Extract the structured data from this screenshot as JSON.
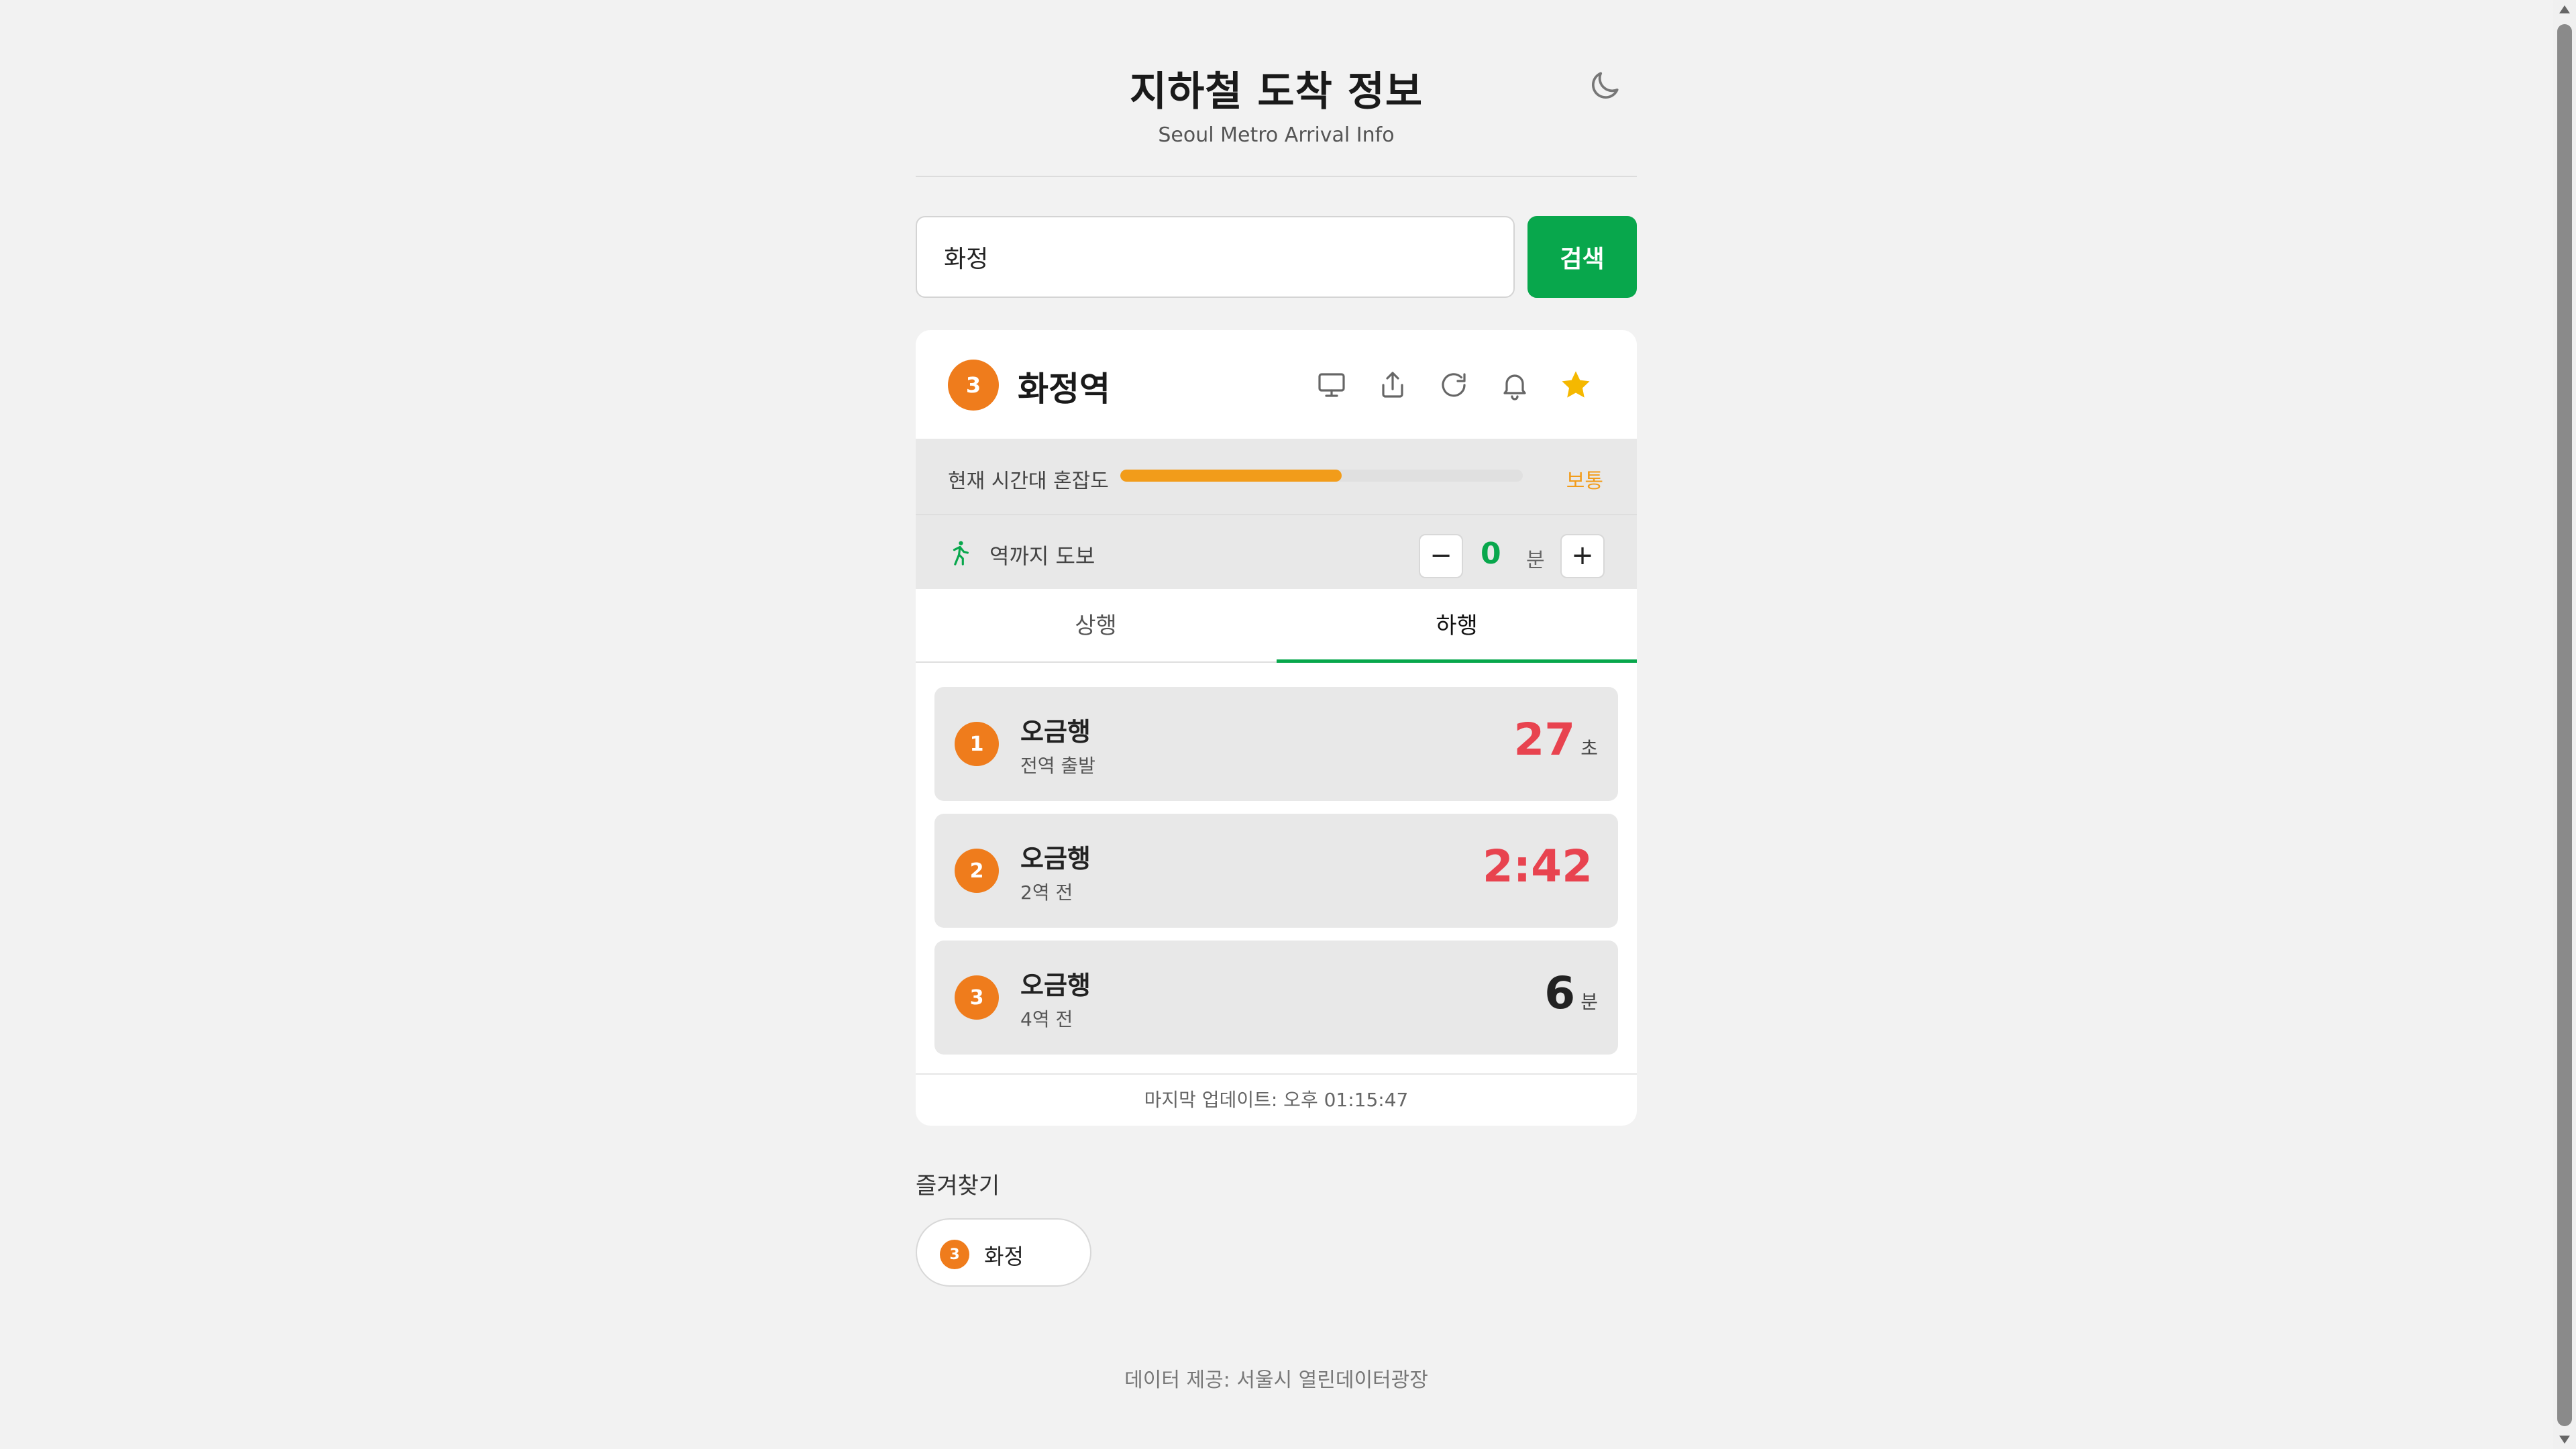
{
  "header": {
    "title": "지하철 도착 정보",
    "subtitle": "Seoul Metro Arrival Info",
    "theme_icon": "moon-icon"
  },
  "search": {
    "value": "화정",
    "button_label": "검색"
  },
  "station": {
    "line": "3",
    "line_color": "#ef7c1c",
    "name": "화정역",
    "icons": [
      "monitor-icon",
      "share-icon",
      "refresh-icon",
      "bell-icon",
      "star-icon"
    ],
    "favorite_color": "#f5b800"
  },
  "congestion": {
    "label": "현재 시간대 혼잡도",
    "level_percent": 55,
    "status": "보통",
    "color": "#f29c1a"
  },
  "walk": {
    "label": "역까지 도보",
    "minutes": "0",
    "unit": "분",
    "minus": "−",
    "plus": "+"
  },
  "tabs": [
    {
      "label": "상행",
      "active": false
    },
    {
      "label": "하행",
      "active": true
    }
  ],
  "arrivals": [
    {
      "order": "1",
      "destination": "오금행",
      "status": "전역 출발",
      "time": "27",
      "unit": "초",
      "urgent": true
    },
    {
      "order": "2",
      "destination": "오금행",
      "status": "2역 전",
      "time": "2:42",
      "unit": "",
      "urgent": true
    },
    {
      "order": "3",
      "destination": "오금행",
      "status": "4역 전",
      "time": "6",
      "unit": "분",
      "urgent": false
    }
  ],
  "last_update": "마지막 업데이트: 오후 01:15:47",
  "favorites": {
    "title": "즐겨찾기",
    "items": [
      {
        "line": "3",
        "name": "화정"
      }
    ]
  },
  "footer": "데이터 제공: 서울시 열린데이터광장",
  "colors": {
    "accent": "#08a74c",
    "urgent": "#e8434f",
    "line3": "#ef7c1c"
  }
}
